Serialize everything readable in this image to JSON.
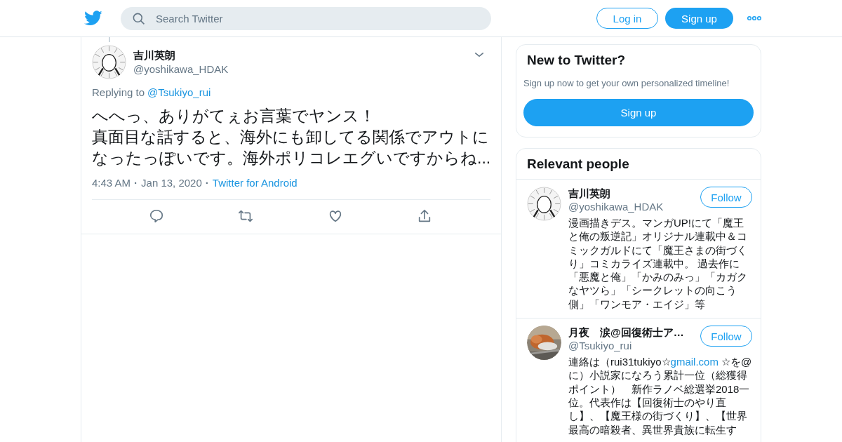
{
  "header": {
    "search": {
      "placeholder": "Search Twitter"
    },
    "login": "Log in",
    "signup": "Sign up"
  },
  "tweet": {
    "name": "吉川英朗",
    "handle": "@yoshikawa_HDAK",
    "replying_label": "Replying to",
    "replying_to": "@Tsukiyo_rui",
    "text_lines": [
      "へへっ、ありがてぇお言葉でヤンス！",
      "真面目な話すると、海外にも卸してる関係でアウトに",
      "なったっぽいです。海外ポリコレエグいですからね..."
    ],
    "time": "4:43 AM",
    "separator_1": "·",
    "date": "Jan 13, 2020",
    "separator_2": "·",
    "source": "Twitter for Android"
  },
  "signup_card": {
    "title": "New to Twitter?",
    "subtitle": "Sign up now to get your own personalized timeline!",
    "button": "Sign up"
  },
  "relevant_people": {
    "title": "Relevant people",
    "people": [
      {
        "kind": "drawing",
        "name": "吉川英朗",
        "handle": "@yoshikawa_HDAK",
        "follow": "Follow",
        "bio": [
          {
            "kind": "text",
            "text": "漫画描きデス。マンガUP!にて「魔王と俺の叛逆記」オリジナル連載中＆コミックガルドにて「魔王さまの街づくり」コミカライズ連載中。 過去作に「悪魔と俺」「かみのみっ」「カガクなヤツら」「シークレットの向こう側」「ワンモア・エイジ」等"
          }
        ]
      },
      {
        "kind": "picture",
        "name": "月夜　涙@回復術士ア…",
        "handle": "@Tsukiyo_rui",
        "follow": "Follow",
        "bio": [
          {
            "kind": "text",
            "text": "連絡は（rui31tukiyo☆"
          },
          {
            "kind": "link",
            "text": "gmail.com"
          },
          {
            "kind": "text",
            "text": " ☆を@に）小説家になろう累計一位（総獲得ポイント）　新作ラノベ総選挙2018一位。代表作は【回復術士のやり直し】、【魔王様の街づくり】、【世界最高の暗殺者、異世界貴族に転生す"
          }
        ]
      }
    ]
  }
}
